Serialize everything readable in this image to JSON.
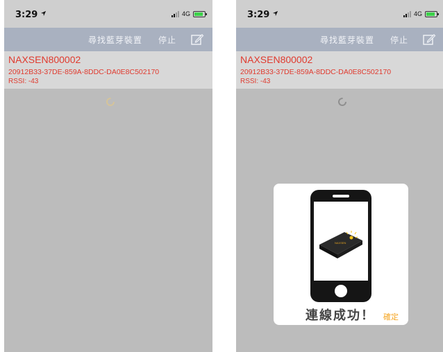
{
  "screens": [
    {
      "status": {
        "time": "3:29",
        "network": "4G"
      },
      "nav": {
        "title": "尋找藍芽裝置",
        "stop": "停止"
      },
      "device": {
        "name": "NAXSEN800002",
        "uuid": "20912B33-37DE-859A-8DDC-DA0E8C502170",
        "rssi": "RSSI: -43"
      }
    },
    {
      "status": {
        "time": "3:29",
        "network": "4G"
      },
      "nav": {
        "title": "尋找藍芽裝置",
        "stop": "停止"
      },
      "device": {
        "name": "NAXSEN800002",
        "uuid": "20912B33-37DE-859A-8DDC-DA0E8C502170",
        "rssi": "RSSI: -43"
      },
      "dialog": {
        "message": "連線成功！",
        "confirm": "確定"
      }
    }
  ],
  "colors": {
    "device_text": "#e03a2e",
    "nav_bar": "#a9b1c0",
    "confirm": "#f5a623",
    "battery": "#3cd34a"
  },
  "icons": [
    "location-arrow-icon",
    "signal-icon",
    "battery-icon",
    "compose-icon",
    "loading-spinner-icon"
  ]
}
